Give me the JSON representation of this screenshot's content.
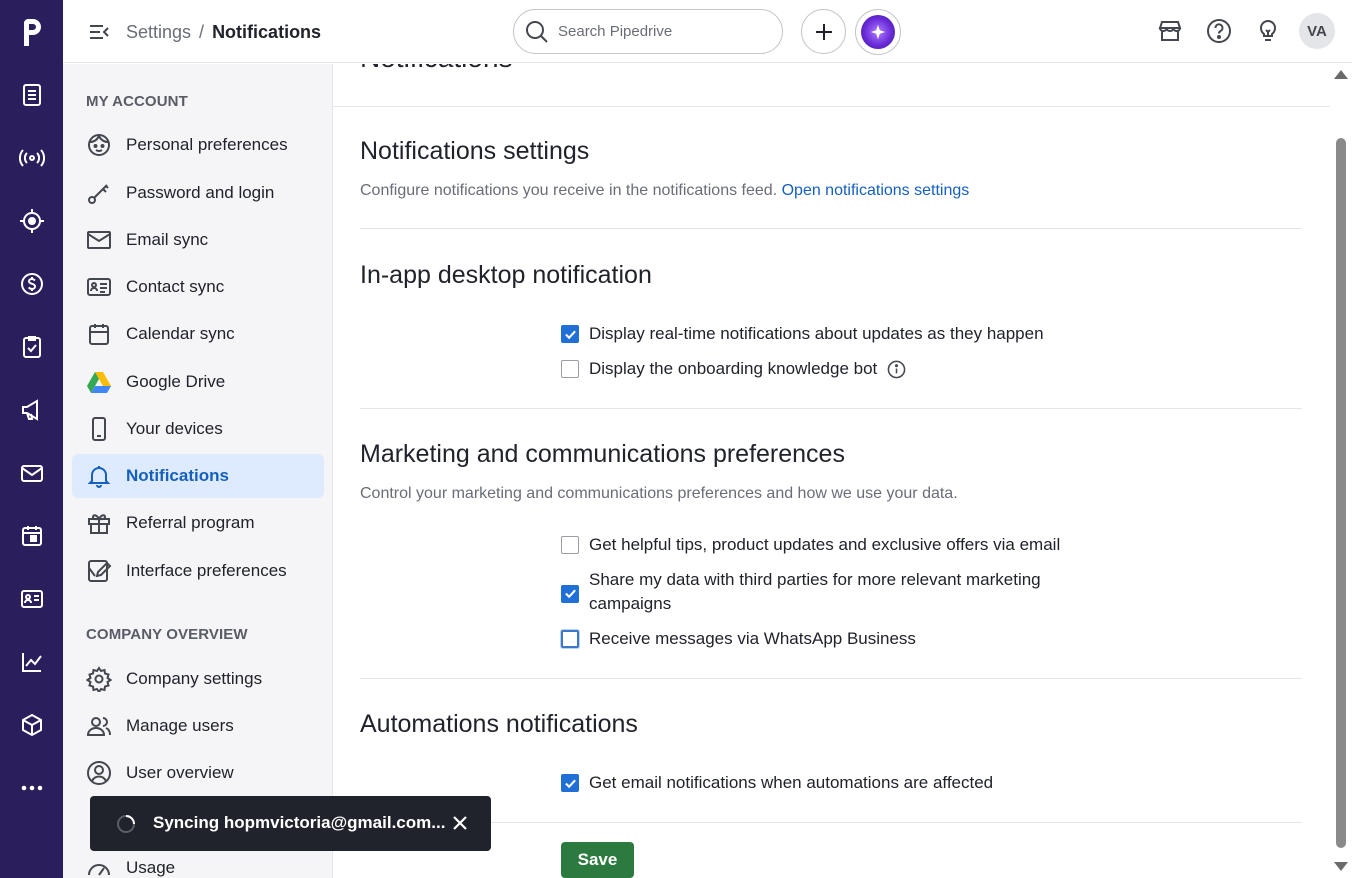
{
  "topbar": {
    "breadcrumb_parent": "Settings",
    "breadcrumb_sep": "/",
    "breadcrumb_current": "Notifications",
    "search_placeholder": "Search Pipedrive",
    "avatar_initials": "VA"
  },
  "sidebar": {
    "section_account": "MY ACCOUNT",
    "account_items": [
      {
        "label": "Personal preferences",
        "icon": "face-icon"
      },
      {
        "label": "Password and login",
        "icon": "key-icon"
      },
      {
        "label": "Email sync",
        "icon": "mail-icon"
      },
      {
        "label": "Contact sync",
        "icon": "contact-card-icon"
      },
      {
        "label": "Calendar sync",
        "icon": "calendar-icon"
      },
      {
        "label": "Google Drive",
        "icon": "google-drive-icon"
      },
      {
        "label": "Your devices",
        "icon": "phone-icon"
      },
      {
        "label": "Notifications",
        "icon": "bell-icon",
        "active": true
      },
      {
        "label": "Referral program",
        "icon": "gift-icon"
      },
      {
        "label": "Interface preferences",
        "icon": "edit-square-icon"
      }
    ],
    "section_company": "COMPANY OVERVIEW",
    "company_items": [
      {
        "label": "Company settings",
        "icon": "gear-icon"
      },
      {
        "label": "Manage users",
        "icon": "users-icon"
      },
      {
        "label": "User overview",
        "icon": "user-circle-icon"
      },
      {
        "label": "Usage",
        "icon": "gauge-icon"
      }
    ]
  },
  "main": {
    "partial_title": "Notifications",
    "notif_settings": {
      "title": "Notifications settings",
      "desc": "Configure notifications you receive in the notifications feed.",
      "link": "Open notifications settings"
    },
    "inapp": {
      "title": "In-app desktop notification",
      "options": [
        {
          "label": "Display real-time notifications about updates as they happen",
          "checked": true
        },
        {
          "label": "Display the onboarding knowledge bot",
          "checked": false
        }
      ]
    },
    "marketing": {
      "title": "Marketing and communications preferences",
      "desc": "Control your marketing and communications preferences and how we use your data.",
      "options": [
        {
          "label": "Get helpful tips, product updates and exclusive offers via email",
          "checked": false
        },
        {
          "label_line1": "Share my data with third parties for more relevant marketing",
          "label_line2": "campaigns",
          "checked": true
        },
        {
          "label": "Receive messages via WhatsApp Business",
          "checked": false
        }
      ]
    },
    "automations": {
      "title": "Automations notifications",
      "options": [
        {
          "label": "Get email notifications when automations are affected",
          "checked": true
        }
      ]
    },
    "save_label": "Save"
  },
  "toast": {
    "message": "Syncing hopmvictoria@gmail.com..."
  },
  "colors": {
    "rail": "#2a1e5c",
    "accent": "#1560bd",
    "save": "#2c7a3f",
    "active_bg": "#deebff"
  }
}
